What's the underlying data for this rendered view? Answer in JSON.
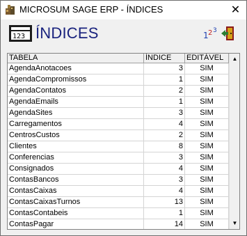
{
  "window": {
    "title": "MICROSUM SAGE ERP - ÍNDICES"
  },
  "header": {
    "title": "ÍNDICES"
  },
  "table": {
    "columns": [
      "TABELA",
      "ÍNDICE",
      "EDITÁVEL"
    ],
    "rows": [
      {
        "tabela": "AgendaAnotacoes",
        "indice": "3",
        "editavel": "SIM"
      },
      {
        "tabela": "AgendaCompromissos",
        "indice": "1",
        "editavel": "SIM"
      },
      {
        "tabela": "AgendaContatos",
        "indice": "2",
        "editavel": "SIM"
      },
      {
        "tabela": "AgendaEmails",
        "indice": "1",
        "editavel": "SIM"
      },
      {
        "tabela": "AgendaSites",
        "indice": "3",
        "editavel": "SIM"
      },
      {
        "tabela": "Carregamentos",
        "indice": "4",
        "editavel": "SIM"
      },
      {
        "tabela": "CentrosCustos",
        "indice": "2",
        "editavel": "SIM"
      },
      {
        "tabela": "Clientes",
        "indice": "8",
        "editavel": "SIM"
      },
      {
        "tabela": "Conferencias",
        "indice": "3",
        "editavel": "SIM"
      },
      {
        "tabela": "Consignados",
        "indice": "4",
        "editavel": "SIM"
      },
      {
        "tabela": "ContasBancos",
        "indice": "3",
        "editavel": "SIM"
      },
      {
        "tabela": "ContasCaixas",
        "indice": "4",
        "editavel": "SIM"
      },
      {
        "tabela": "ContasCaixasTurnos",
        "indice": "13",
        "editavel": "SIM"
      },
      {
        "tabela": "ContasContabeis",
        "indice": "1",
        "editavel": "SIM"
      },
      {
        "tabela": "ContasPagar",
        "indice": "14",
        "editavel": "SIM"
      }
    ]
  },
  "icons": {
    "app": "app-icon",
    "header": "keypad-icon",
    "order": "numbering-icon",
    "exit": "exit-door-icon",
    "close": "close-icon"
  },
  "colors": {
    "header_title": "#1a237e",
    "grid_border": "#828282"
  }
}
